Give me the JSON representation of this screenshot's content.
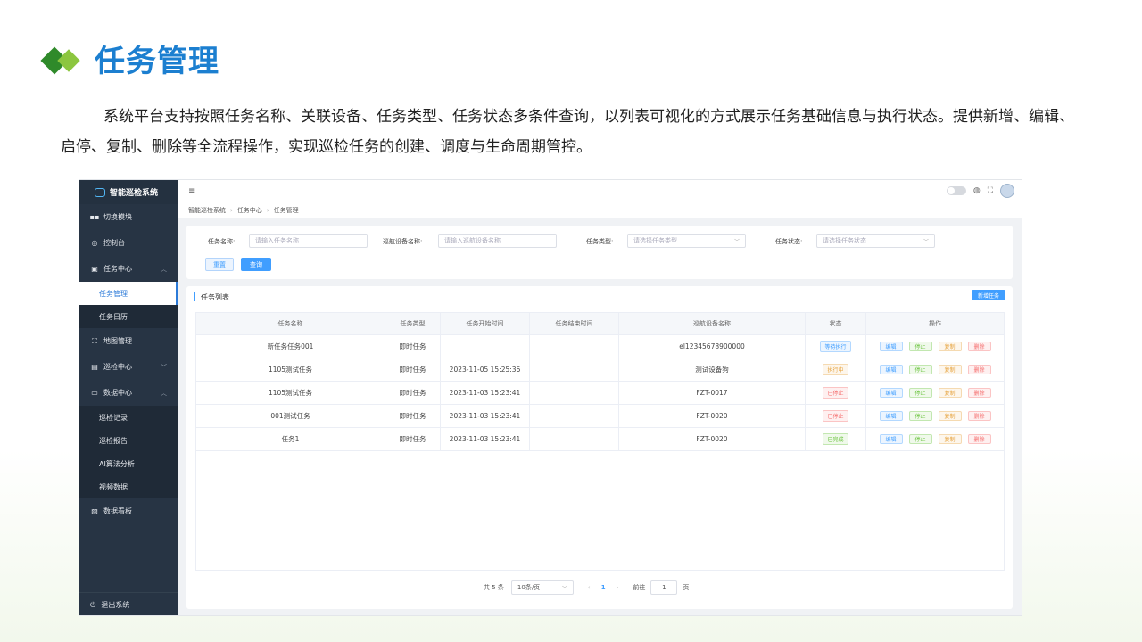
{
  "slide": {
    "title": "任务管理",
    "description": "系统平台支持按照任务名称、关联设备、任务类型、任务状态多条件查询，以列表可视化的方式展示任务基础信息与执行状态。提供新增、编辑、启停、复制、删除等全流程操作，实现巡检任务的创建、调度与生命周期管控。"
  },
  "app": {
    "logo_text": "智能巡检系统",
    "sidebar": {
      "switch_module": "切换模块",
      "console": "控制台",
      "task_center": "任务中心",
      "task_manage": "任务管理",
      "task_calendar": "任务日历",
      "map_manage": "地图管理",
      "patrol_center": "巡检中心",
      "data_center": "数据中心",
      "patrol_record": "巡检记录",
      "patrol_report": "巡检报告",
      "ai_analysis": "AI算法分析",
      "video_data": "视频数据",
      "data_dashboard": "数据看板",
      "logout": "退出系统"
    },
    "topbar": {
      "menu_glyph": "≡"
    },
    "breadcrumb": [
      "智能巡检系统",
      "任务中心",
      "任务管理"
    ],
    "filters": {
      "task_name_label": "任务名称:",
      "task_name_placeholder": "请输入任务名称",
      "device_label": "巡航设备名称:",
      "device_placeholder": "请输入巡航设备名称",
      "type_label": "任务类型:",
      "type_placeholder": "请选择任务类型",
      "status_label": "任务状态:",
      "status_placeholder": "请选择任务状态",
      "reset": "重置",
      "query": "查询"
    },
    "list": {
      "title": "任务列表",
      "add_button": "新增任务",
      "columns": [
        "任务名称",
        "任务类型",
        "任务开始时间",
        "任务结束时间",
        "巡航设备名称",
        "状态",
        "操作"
      ],
      "rows": [
        {
          "name": "新任务任务001",
          "type": "即时任务",
          "start": "",
          "end": "",
          "device": "el12345678900000",
          "status": "等待执行",
          "status_color": "blue"
        },
        {
          "name": "1105测试任务",
          "type": "即时任务",
          "start": "2023-11-05 15:25:36",
          "end": "",
          "device": "测试设备狗",
          "status": "执行中",
          "status_color": "orange"
        },
        {
          "name": "1105测试任务",
          "type": "即时任务",
          "start": "2023-11-03 15:23:41",
          "end": "",
          "device": "FZT-0017",
          "status": "已停止",
          "status_color": "red"
        },
        {
          "name": "001测试任务",
          "type": "即时任务",
          "start": "2023-11-03 15:23:41",
          "end": "",
          "device": "FZT-0020",
          "status": "已停止",
          "status_color": "red"
        },
        {
          "name": "任务1",
          "type": "即时任务",
          "start": "2023-11-03 15:23:41",
          "end": "",
          "device": "FZT-0020",
          "status": "已完成",
          "status_color": "green"
        }
      ],
      "ops": {
        "edit": "编辑",
        "stop": "停止",
        "copy": "复制",
        "delete": "删除"
      }
    },
    "pager": {
      "total": "共 5 条",
      "page_size": "10条/页",
      "prev": "‹",
      "current": "1",
      "next": "›",
      "goto_label": "前往",
      "goto_value": "1",
      "page_suffix": "页"
    }
  }
}
